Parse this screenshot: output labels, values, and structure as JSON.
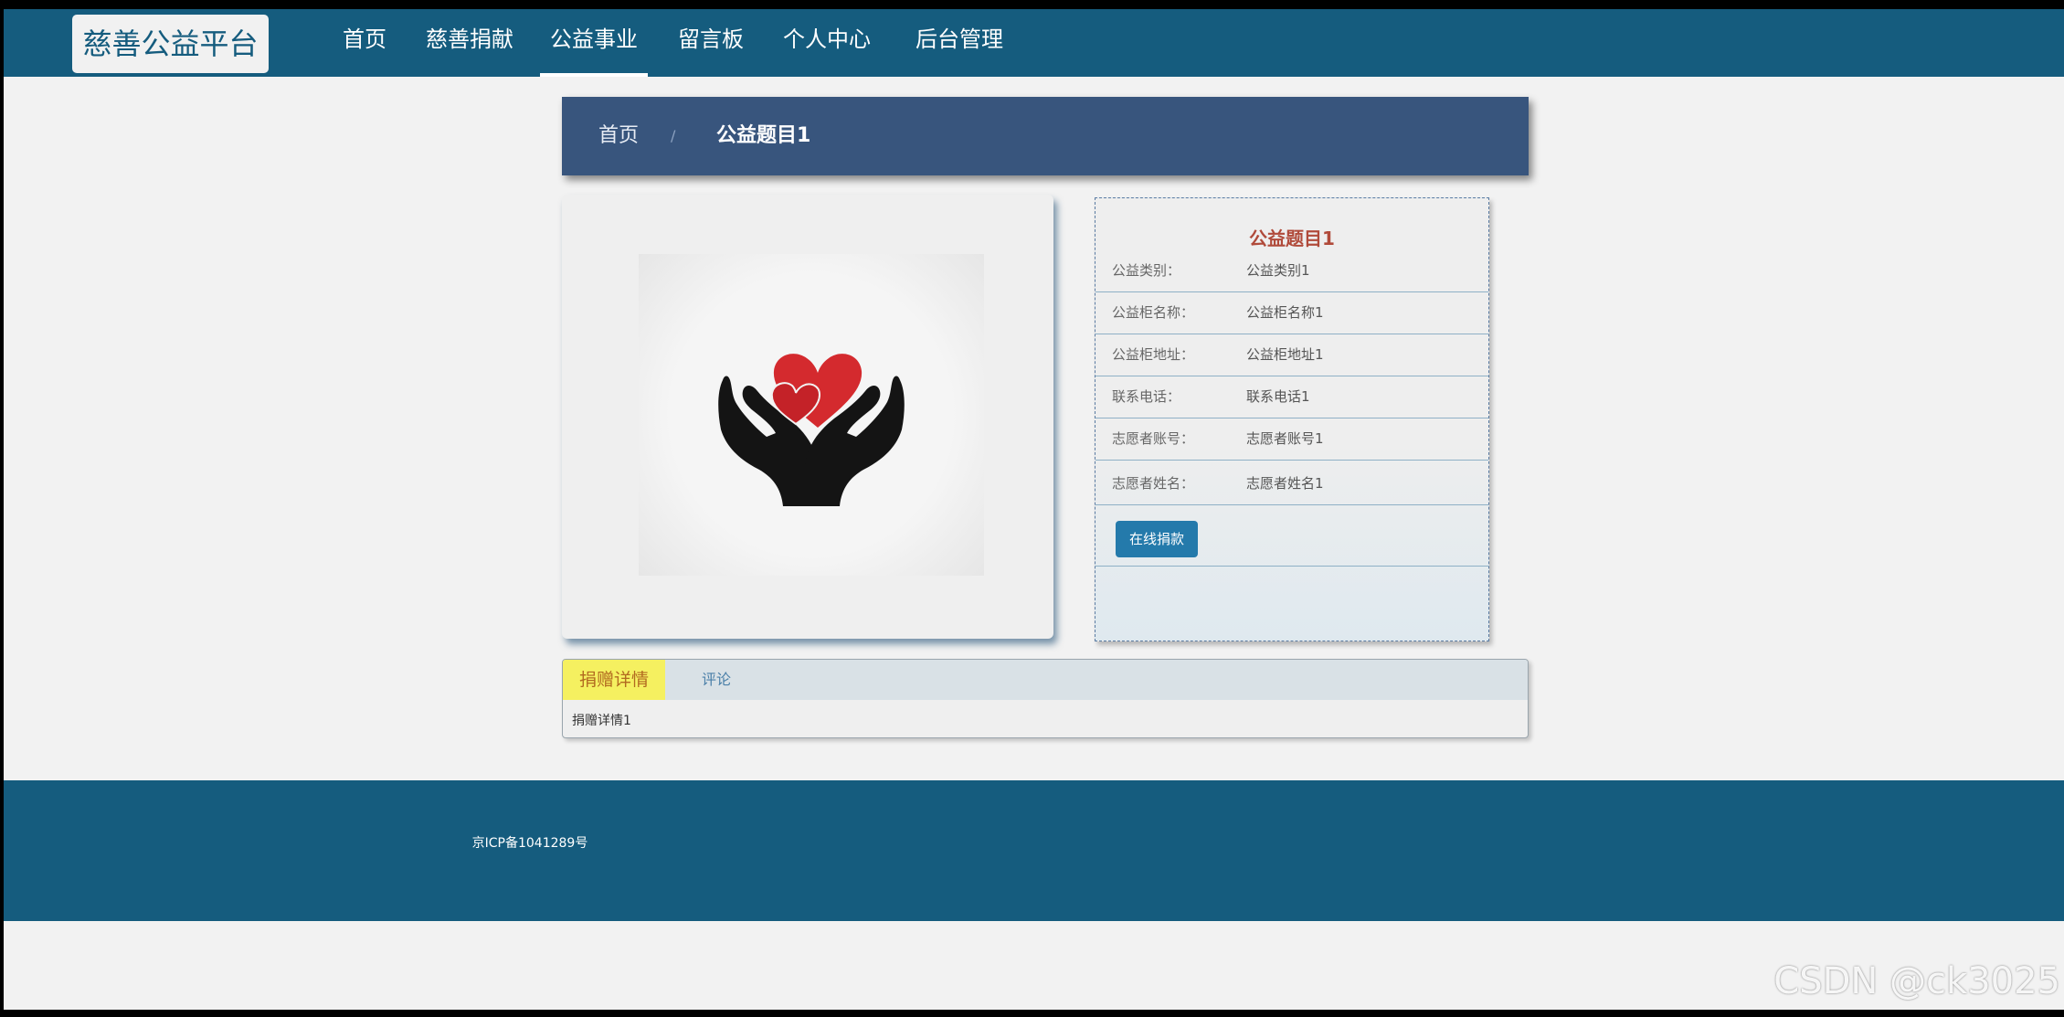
{
  "brand": {
    "logo_text": "慈善公益平台"
  },
  "nav": {
    "items": [
      {
        "label": "首页"
      },
      {
        "label": "慈善捐献"
      },
      {
        "label": "公益事业"
      },
      {
        "label": "留言板"
      },
      {
        "label": "个人中心"
      },
      {
        "label": "后台管理"
      }
    ],
    "active": "公益事业"
  },
  "breadcrumb": {
    "home": "首页",
    "separator": "/",
    "current": "公益题目1"
  },
  "detail": {
    "image": "charity-hands-heart-icon",
    "title": "公益题目1",
    "fields": [
      {
        "label": "公益类别：",
        "value": "公益类别1"
      },
      {
        "label": "公益柜名称：",
        "value": "公益柜名称1"
      },
      {
        "label": "公益柜地址：",
        "value": "公益柜地址1"
      },
      {
        "label": "联系电话：",
        "value": "联系电话1"
      },
      {
        "label": "志愿者账号：",
        "value": "志愿者账号1"
      },
      {
        "label": "志愿者姓名：",
        "value": "志愿者姓名1"
      }
    ],
    "donate_button": "在线捐款"
  },
  "tabs": {
    "items": [
      {
        "label": "捐赠详情"
      },
      {
        "label": "评论"
      }
    ],
    "active_content": "捐赠详情1"
  },
  "footer": {
    "icp": "京ICP备1041289号"
  },
  "watermark": "CSDN @ck3025",
  "colors": {
    "navbar": "#155c7e",
    "breadcrumb": "#38557d",
    "button": "#247aab",
    "title": "#b04a3a",
    "active_tab": "#f5f060"
  }
}
